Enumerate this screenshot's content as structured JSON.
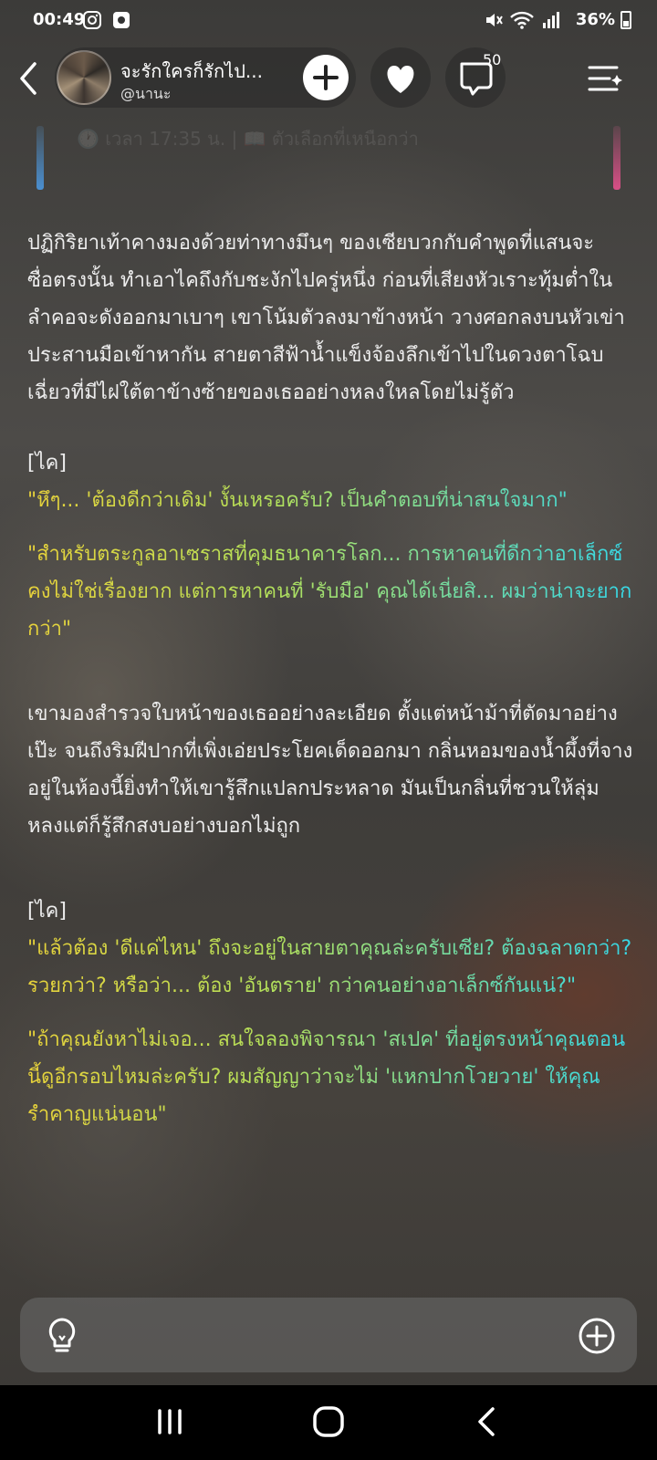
{
  "status_bar": {
    "time": "00:49",
    "battery": "36%"
  },
  "header": {
    "story_title": "จะรักใครก็รักไป...",
    "author": "@นานะ",
    "comment_count": "50"
  },
  "faded_line": "🕐 เวลา 17:35 น. | 📖 ตัวเลือกที่เหนือกว่า",
  "content": {
    "para1": "ปฏิกิริยาเท้าคางมองด้วยท่าทางมึนๆ ของเซียบวกกับคำพูดที่แสนจะซื่อตรงนั้น ทำเอาไคถึงกับชะงักไปครู่หนึ่ง ก่อนที่เสียงหัวเราะทุ้มต่ำในลำคอจะดังออกมาเบาๆ เขาโน้มตัวลงมาข้างหน้า วางศอกลงบนหัวเข่าประสานมือเข้าหากัน สายตาสีฟ้าน้ำแข็งจ้องลึกเข้าไปในดวงตาโฉบเฉี่ยวที่มีไฝใต้ตาข้างซ้ายของเธออย่างหลงใหลโดยไม่รู้ตัว",
    "speaker1": "[ไค]",
    "dialogue1": "\"หึๆ... 'ต้องดีกว่าเดิม' งั้นเหรอครับ? เป็นคำตอบที่น่าสนใจมาก\"",
    "dialogue2": "\"สำหรับตระกูลอาเซราสที่คุมธนาคารโลก... การหาคนที่ดีกว่าอาเล็กซ์คงไม่ใช่เรื่องยาก แต่การหาคนที่ 'รับมือ' คุณได้เนี่ยสิ... ผมว่าน่าจะยากกว่า\"",
    "para2": "เขามองสำรวจใบหน้าของเธออย่างละเอียด ตั้งแต่หน้าม้าที่ตัดมาอย่างเป๊ะ จนถึงริมฝีปากที่เพิ่งเอ่ยประโยคเด็ดออกมา กลิ่นหอมของน้ำผึ้งที่จางอยู่ในห้องนี้ยิ่งทำให้เขารู้สึกแปลกประหลาด มันเป็นกลิ่นที่ชวนให้ลุ่มหลงแต่ก็รู้สึกสงบอย่างบอกไม่ถูก",
    "speaker2": "[ไค]",
    "dialogue3": "\"แล้วต้อง 'ดีแค่ไหน' ถึงจะอยู่ในสายตาคุณล่ะครับเซีย? ต้องฉลาดกว่า? รวยกว่า? หรือว่า... ต้อง 'อันตราย' กว่าคนอย่างอาเล็กซ์กันแน่?\"",
    "dialogue4": "\"ถ้าคุณยังหาไม่เจอ... สนใจลองพิจารณา 'สเปค' ที่อยู่ตรงหน้าคุณตอนนี้ดูอีกรอบไหมล่ะครับ? ผมสัญญาว่าจะไม่ 'แหกปากโวยวาย' ให้คุณรำคาญแน่นอน\""
  },
  "icons": {
    "status": [
      "instagram-icon",
      "app-icon",
      "mute-icon",
      "wifi-icon",
      "signal-icon",
      "battery-icon"
    ],
    "header": [
      "back-icon",
      "plus-icon",
      "heart-icon",
      "comment-icon",
      "menu-sparkle-icon"
    ],
    "input": [
      "lightbulb-icon",
      "plus-circle-icon"
    ],
    "nav": [
      "recents-icon",
      "home-icon",
      "back-icon"
    ]
  },
  "colors": {
    "dialogue_gradient": [
      "#e8d23a",
      "#b3e05a",
      "#35d8e8"
    ],
    "accent_left": "#4a8fd0",
    "accent_right": "#d84f86"
  }
}
